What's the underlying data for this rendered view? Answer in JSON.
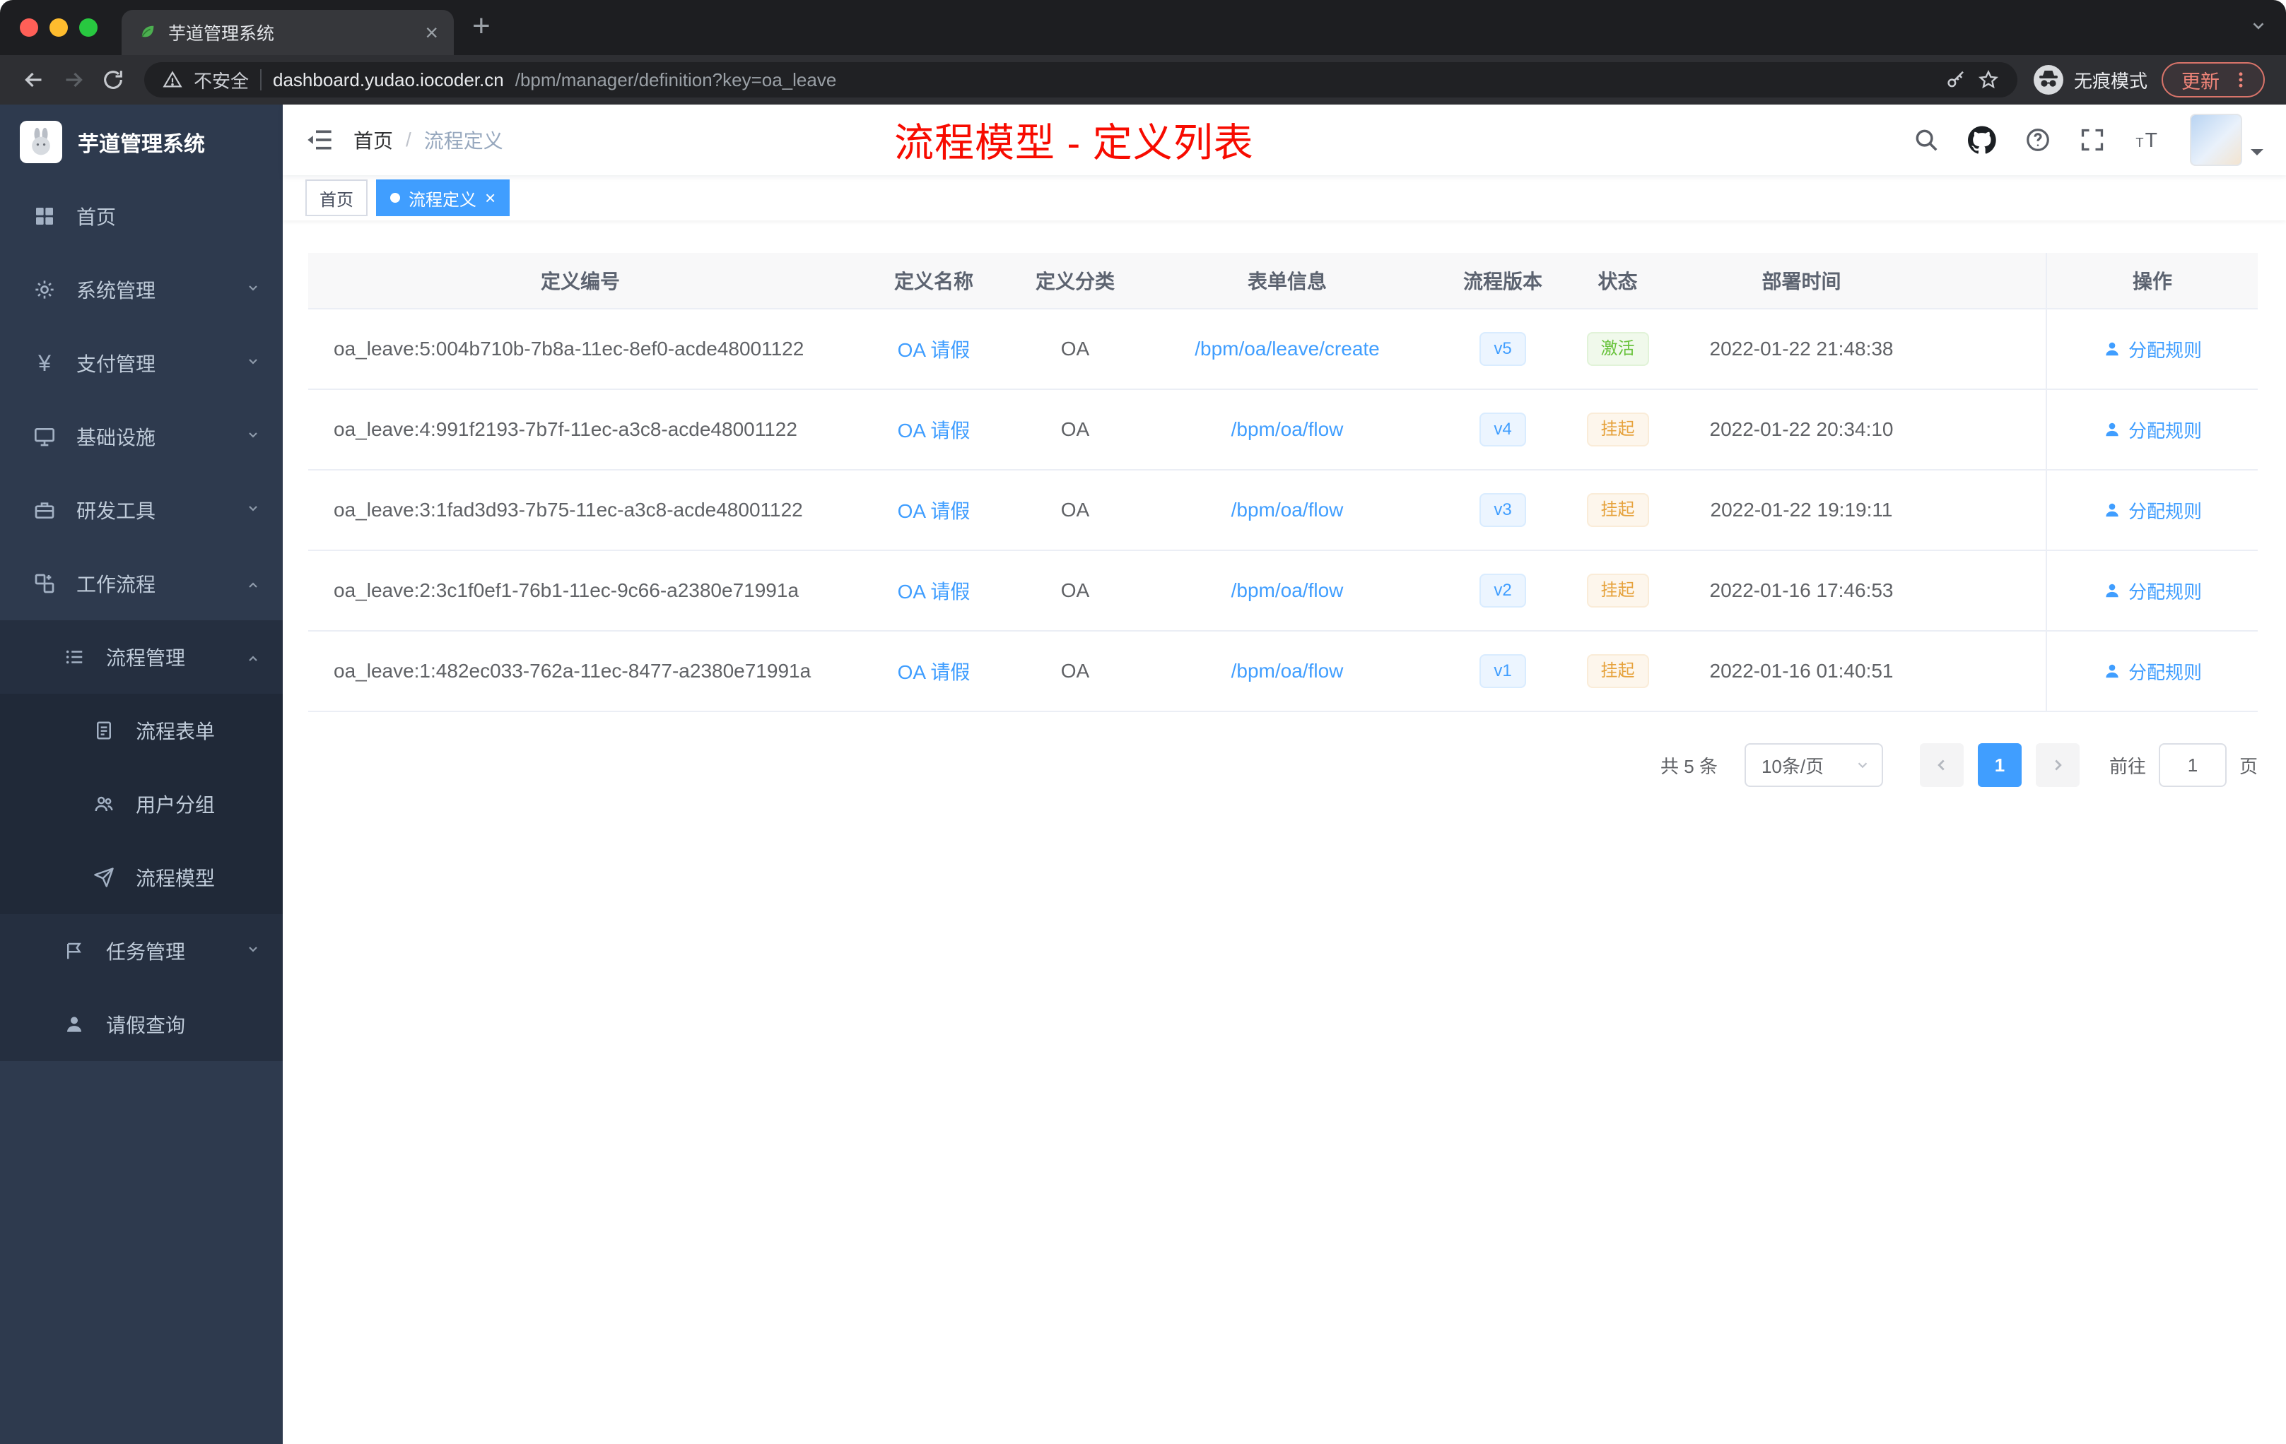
{
  "browser": {
    "tab_title": "芋道管理系统",
    "security_label": "不安全",
    "url_host": "dashboard.yudao.iocoder.cn",
    "url_path": "/bpm/manager/definition?key=oa_leave",
    "incognito_label": "无痕模式",
    "update_label": "更新"
  },
  "sidebar": {
    "logo_title": "芋道管理系统",
    "items": [
      {
        "label": "首页"
      },
      {
        "label": "系统管理"
      },
      {
        "label": "支付管理"
      },
      {
        "label": "基础设施"
      },
      {
        "label": "研发工具"
      },
      {
        "label": "工作流程"
      },
      {
        "label": "流程管理"
      },
      {
        "label": "流程表单"
      },
      {
        "label": "用户分组"
      },
      {
        "label": "流程模型"
      },
      {
        "label": "任务管理"
      },
      {
        "label": "请假查询"
      }
    ]
  },
  "header": {
    "breadcrumb": {
      "home": "首页",
      "separator": "/",
      "current": "流程定义"
    },
    "annotation": "流程模型 - 定义列表"
  },
  "tags_view": {
    "tags": [
      {
        "label": "首页",
        "active": false
      },
      {
        "label": "流程定义",
        "active": true
      }
    ]
  },
  "table": {
    "columns": [
      "定义编号",
      "定义名称",
      "定义分类",
      "表单信息",
      "流程版本",
      "状态",
      "部署时间",
      "操作"
    ],
    "rows": [
      {
        "id": "oa_leave:5:004b710b-7b8a-11ec-8ef0-acde48001122",
        "name": "OA 请假",
        "category": "OA",
        "form": "/bpm/oa/leave/create",
        "version": "v5",
        "status": "激活",
        "status_type": "success",
        "deploy_time": "2022-01-22 21:48:38",
        "action": "分配规则"
      },
      {
        "id": "oa_leave:4:991f2193-7b7f-11ec-a3c8-acde48001122",
        "name": "OA 请假",
        "category": "OA",
        "form": "/bpm/oa/flow",
        "version": "v4",
        "status": "挂起",
        "status_type": "warning",
        "deploy_time": "2022-01-22 20:34:10",
        "action": "分配规则"
      },
      {
        "id": "oa_leave:3:1fad3d93-7b75-11ec-a3c8-acde48001122",
        "name": "OA 请假",
        "category": "OA",
        "form": "/bpm/oa/flow",
        "version": "v3",
        "status": "挂起",
        "status_type": "warning",
        "deploy_time": "2022-01-22 19:19:11",
        "action": "分配规则"
      },
      {
        "id": "oa_leave:2:3c1f0ef1-76b1-11ec-9c66-a2380e71991a",
        "name": "OA 请假",
        "category": "OA",
        "form": "/bpm/oa/flow",
        "version": "v2",
        "status": "挂起",
        "status_type": "warning",
        "deploy_time": "2022-01-16 17:46:53",
        "action": "分配规则"
      },
      {
        "id": "oa_leave:1:482ec033-762a-11ec-8477-a2380e71991a",
        "name": "OA 请假",
        "category": "OA",
        "form": "/bpm/oa/flow",
        "version": "v1",
        "status": "挂起",
        "status_type": "warning",
        "deploy_time": "2022-01-16 01:40:51",
        "action": "分配规则"
      }
    ]
  },
  "pagination": {
    "total": "共 5 条",
    "page_size": "10条/页",
    "current_page": "1",
    "goto_label": "前往",
    "goto_value": "1",
    "page_label": "页"
  },
  "colors": {
    "accent": "#409eff",
    "success": "#67c23a",
    "warning": "#e6a23c",
    "annotation_red": "#f70b00"
  }
}
